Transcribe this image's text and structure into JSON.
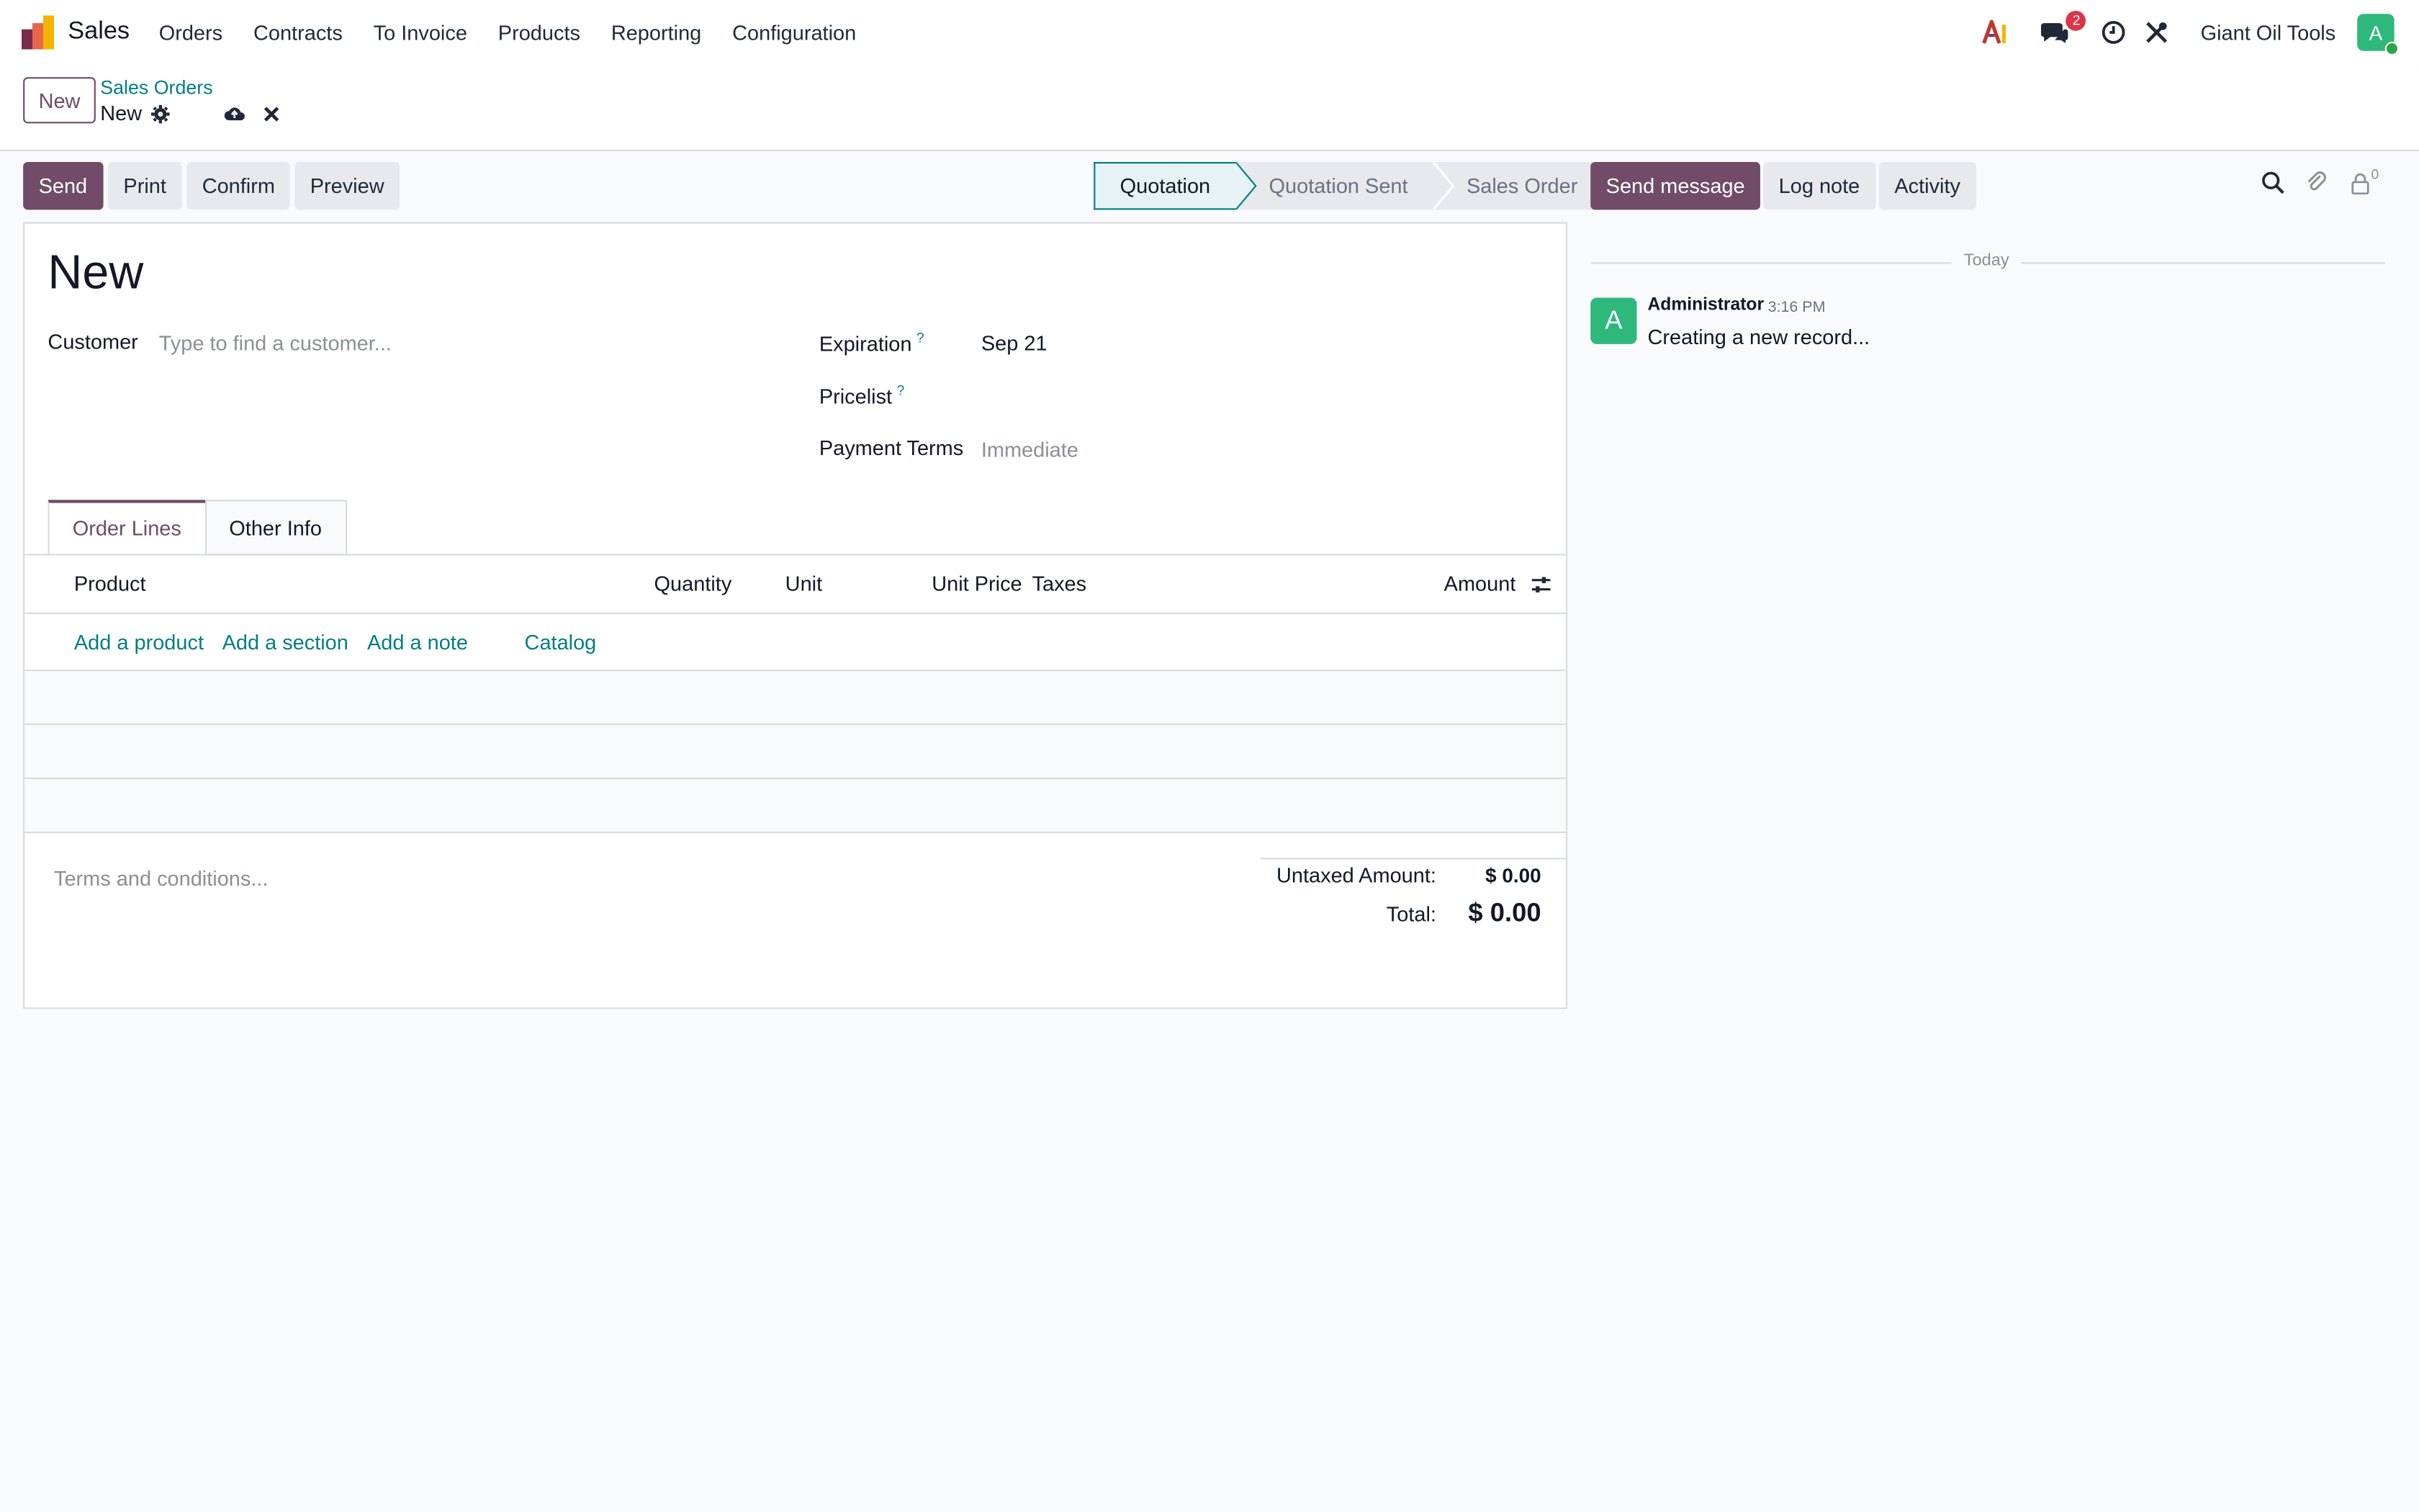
{
  "navbar": {
    "app_name": "Sales",
    "menu": [
      "Orders",
      "Contracts",
      "To Invoice",
      "Products",
      "Reporting",
      "Configuration"
    ],
    "messages_badge": "2",
    "company": "Giant Oil Tools",
    "user_initial": "A"
  },
  "control": {
    "new_button": "New",
    "breadcrumb_parent": "Sales Orders",
    "breadcrumb_current": "New"
  },
  "actions": {
    "send": "Send",
    "print": "Print",
    "confirm": "Confirm",
    "preview": "Preview"
  },
  "statusbar": {
    "stages": [
      "Quotation",
      "Quotation Sent",
      "Sales Order"
    ],
    "active": "Quotation"
  },
  "form": {
    "title": "New",
    "customer_label": "Customer",
    "customer_placeholder": "Type to find a customer...",
    "expiration_label": "Expiration",
    "expiration_value": "Sep 21",
    "pricelist_label": "Pricelist",
    "payment_terms_label": "Payment Terms",
    "payment_terms_placeholder": "Immediate",
    "help_mark": "?",
    "tabs": [
      "Order Lines",
      "Other Info"
    ],
    "columns": [
      "Product",
      "Quantity",
      "Unit",
      "Unit Price",
      "Taxes",
      "Amount"
    ],
    "add_links": [
      "Add a product",
      "Add a section",
      "Add a note",
      "Catalog"
    ],
    "terms_placeholder": "Terms and conditions...",
    "untaxed_label": "Untaxed Amount:",
    "untaxed_value": "$ 0.00",
    "total_label": "Total:",
    "total_value": "$ 0.00"
  },
  "chatter": {
    "send_message": "Send message",
    "log_note": "Log note",
    "activity": "Activity",
    "followers_count": "0",
    "date_separator": "Today",
    "message": {
      "author": "Administrator",
      "time": "3:16 PM",
      "body": "Creating a new record...",
      "avatar_initial": "A"
    }
  },
  "colors": {
    "primary": "#714b67",
    "link": "#017e84",
    "avatar": "#2eb87c"
  }
}
